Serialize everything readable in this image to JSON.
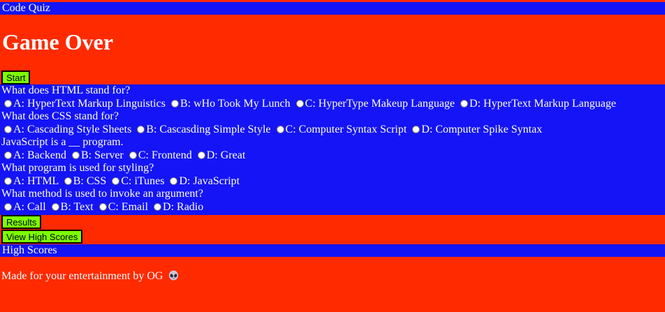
{
  "header": {
    "title": "Code Quiz",
    "heading": "Game Over",
    "start_label": "Start"
  },
  "questions": [
    {
      "text": "What does HTML stand for?",
      "answers": [
        "A: HyperText Markup Linguistics",
        "B: wHo Took My Lunch",
        "C: HyperType Makeup Language",
        "D: HyperText Markup Language"
      ]
    },
    {
      "text": "What does CSS stand for?",
      "answers": [
        "A: Cascading Style Sheets",
        "B: Cascasding Simple Style",
        "C: Computer Syntax Script",
        "D: Computer Spike Syntax"
      ]
    },
    {
      "text": "JavaScript is a __ program.",
      "answers": [
        "A: Backend",
        "B: Server",
        "C: Frontend",
        "D: Great"
      ]
    },
    {
      "text": "What program is used for styling?",
      "answers": [
        "A: HTML",
        "B: CSS",
        "C: iTunes",
        "D: JavaScript"
      ]
    },
    {
      "text": "What method is used to invoke an argument?",
      "answers": [
        "A: Call",
        "B: Text",
        "C: Email",
        "D: Radio"
      ]
    }
  ],
  "buttons": {
    "results_label": "Results",
    "view_high_scores_label": "View High Scores"
  },
  "high_scores": {
    "title": "High Scores"
  },
  "footer": {
    "text": "Made for your entertainment by OG",
    "icon": "alien-icon"
  },
  "colors": {
    "background": "#ff2a00",
    "bar": "#1414f6",
    "button": "#7cff00"
  }
}
